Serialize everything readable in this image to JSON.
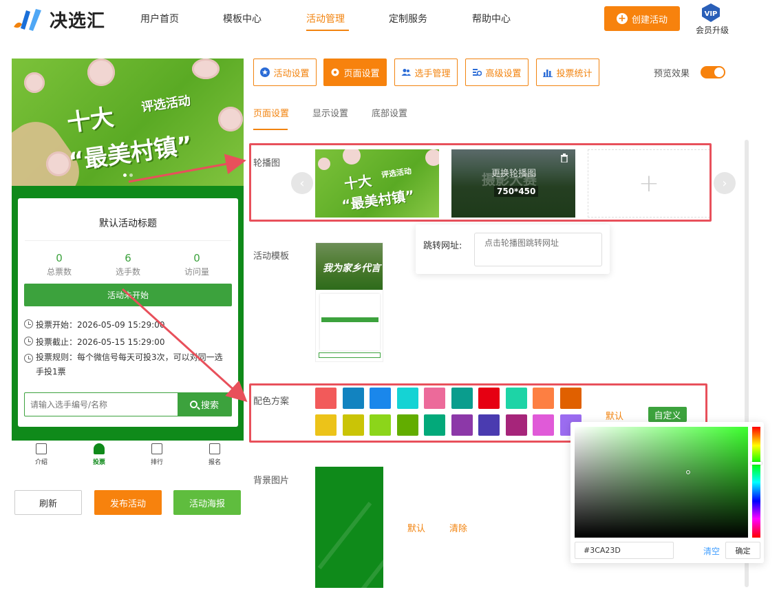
{
  "brand": {
    "name": "决选汇"
  },
  "nav": {
    "items": [
      "用户首页",
      "模板中心",
      "活动管理",
      "定制服务",
      "帮助中心"
    ],
    "active_index": 2
  },
  "header": {
    "create_label": "创建活动",
    "vip_badge": "VIP",
    "vip_label": "会员升级"
  },
  "phone": {
    "banner": {
      "line1": "十大",
      "line2": "评选活动",
      "line3": "“最美村镇”"
    },
    "card_title": "默认活动标题",
    "stats": [
      {
        "value": "0",
        "label": "总票数"
      },
      {
        "value": "6",
        "label": "选手数"
      },
      {
        "value": "0",
        "label": "访问量"
      }
    ],
    "status": "活动未开始",
    "vote_start": "投票开始：2026-05-09 15:29:00",
    "vote_end": "投票截止：2026-05-15 15:29:00",
    "vote_rule": "投票规则：每个微信号每天可投3次，可以对同一选手投1票",
    "search_placeholder": "请输入选手编号/名称",
    "search_label": "搜索",
    "tabs": [
      "介绍",
      "投票",
      "排行",
      "报名"
    ],
    "active_tab": 1
  },
  "actions": {
    "refresh": "刷新",
    "publish": "发布活动",
    "poster": "活动海报"
  },
  "panel": {
    "tabs": [
      "活动设置",
      "页面设置",
      "选手管理",
      "高级设置",
      "投票统计"
    ],
    "active_tab": 1,
    "preview_label": "预览效果",
    "preview_on": true,
    "sub_tabs": [
      "页面设置",
      "显示设置",
      "底部设置"
    ],
    "active_sub_tab": 0
  },
  "carousel": {
    "label": "轮播图",
    "replace_label": "更换轮播图",
    "size_label": "750*450",
    "watermark": "摄影大赛",
    "jump_label": "跳转网址:",
    "jump_placeholder": "点击轮播图跳转网址"
  },
  "template": {
    "label": "活动模板",
    "thumb_headline": "我为家乡代言"
  },
  "colors": {
    "label": "配色方案",
    "swatches": [
      "#f25a5a",
      "#1283c0",
      "#1a87eb",
      "#15d3d4",
      "#ec6a9a",
      "#0a9d8d",
      "#e60012",
      "#1dd4a6",
      "#fd7f42",
      "#e06000",
      "#ecc319",
      "#cac406",
      "#8cd51a",
      "#62ad00",
      "#03a97a",
      "#8c38a8",
      "#4a3bb0",
      "#a6257a",
      "#e05ad8",
      "#9b6cf0"
    ],
    "default_label": "默认",
    "custom_label": "自定义"
  },
  "picker": {
    "hex": "#3CA23D",
    "clear_label": "清空",
    "ok_label": "确定"
  },
  "background": {
    "label": "背景图片",
    "default_label": "默认",
    "clear_label": "清除"
  },
  "accent": "#f7820d",
  "theme_green": "#3ca23d"
}
